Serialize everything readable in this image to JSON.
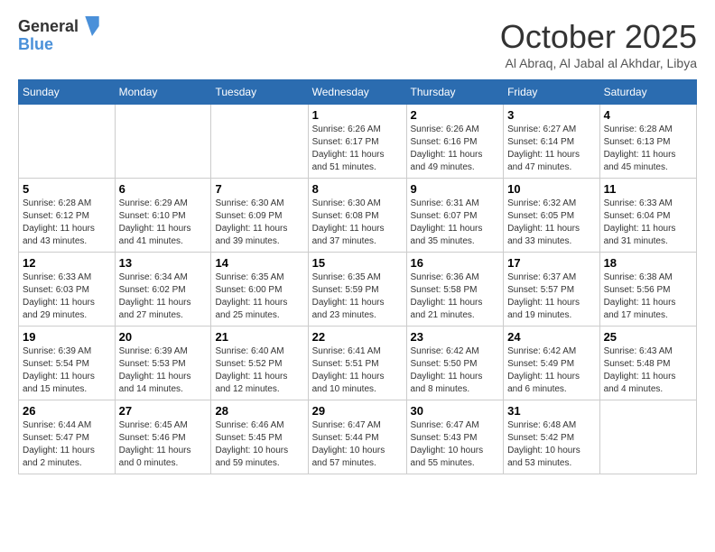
{
  "header": {
    "logo_line1": "General",
    "logo_line2": "Blue",
    "month": "October 2025",
    "location": "Al Abraq, Al Jabal al Akhdar, Libya"
  },
  "weekdays": [
    "Sunday",
    "Monday",
    "Tuesday",
    "Wednesday",
    "Thursday",
    "Friday",
    "Saturday"
  ],
  "weeks": [
    [
      {
        "day": "",
        "info": ""
      },
      {
        "day": "",
        "info": ""
      },
      {
        "day": "",
        "info": ""
      },
      {
        "day": "1",
        "info": "Sunrise: 6:26 AM\nSunset: 6:17 PM\nDaylight: 11 hours\nand 51 minutes."
      },
      {
        "day": "2",
        "info": "Sunrise: 6:26 AM\nSunset: 6:16 PM\nDaylight: 11 hours\nand 49 minutes."
      },
      {
        "day": "3",
        "info": "Sunrise: 6:27 AM\nSunset: 6:14 PM\nDaylight: 11 hours\nand 47 minutes."
      },
      {
        "day": "4",
        "info": "Sunrise: 6:28 AM\nSunset: 6:13 PM\nDaylight: 11 hours\nand 45 minutes."
      }
    ],
    [
      {
        "day": "5",
        "info": "Sunrise: 6:28 AM\nSunset: 6:12 PM\nDaylight: 11 hours\nand 43 minutes."
      },
      {
        "day": "6",
        "info": "Sunrise: 6:29 AM\nSunset: 6:10 PM\nDaylight: 11 hours\nand 41 minutes."
      },
      {
        "day": "7",
        "info": "Sunrise: 6:30 AM\nSunset: 6:09 PM\nDaylight: 11 hours\nand 39 minutes."
      },
      {
        "day": "8",
        "info": "Sunrise: 6:30 AM\nSunset: 6:08 PM\nDaylight: 11 hours\nand 37 minutes."
      },
      {
        "day": "9",
        "info": "Sunrise: 6:31 AM\nSunset: 6:07 PM\nDaylight: 11 hours\nand 35 minutes."
      },
      {
        "day": "10",
        "info": "Sunrise: 6:32 AM\nSunset: 6:05 PM\nDaylight: 11 hours\nand 33 minutes."
      },
      {
        "day": "11",
        "info": "Sunrise: 6:33 AM\nSunset: 6:04 PM\nDaylight: 11 hours\nand 31 minutes."
      }
    ],
    [
      {
        "day": "12",
        "info": "Sunrise: 6:33 AM\nSunset: 6:03 PM\nDaylight: 11 hours\nand 29 minutes."
      },
      {
        "day": "13",
        "info": "Sunrise: 6:34 AM\nSunset: 6:02 PM\nDaylight: 11 hours\nand 27 minutes."
      },
      {
        "day": "14",
        "info": "Sunrise: 6:35 AM\nSunset: 6:00 PM\nDaylight: 11 hours\nand 25 minutes."
      },
      {
        "day": "15",
        "info": "Sunrise: 6:35 AM\nSunset: 5:59 PM\nDaylight: 11 hours\nand 23 minutes."
      },
      {
        "day": "16",
        "info": "Sunrise: 6:36 AM\nSunset: 5:58 PM\nDaylight: 11 hours\nand 21 minutes."
      },
      {
        "day": "17",
        "info": "Sunrise: 6:37 AM\nSunset: 5:57 PM\nDaylight: 11 hours\nand 19 minutes."
      },
      {
        "day": "18",
        "info": "Sunrise: 6:38 AM\nSunset: 5:56 PM\nDaylight: 11 hours\nand 17 minutes."
      }
    ],
    [
      {
        "day": "19",
        "info": "Sunrise: 6:39 AM\nSunset: 5:54 PM\nDaylight: 11 hours\nand 15 minutes."
      },
      {
        "day": "20",
        "info": "Sunrise: 6:39 AM\nSunset: 5:53 PM\nDaylight: 11 hours\nand 14 minutes."
      },
      {
        "day": "21",
        "info": "Sunrise: 6:40 AM\nSunset: 5:52 PM\nDaylight: 11 hours\nand 12 minutes."
      },
      {
        "day": "22",
        "info": "Sunrise: 6:41 AM\nSunset: 5:51 PM\nDaylight: 11 hours\nand 10 minutes."
      },
      {
        "day": "23",
        "info": "Sunrise: 6:42 AM\nSunset: 5:50 PM\nDaylight: 11 hours\nand 8 minutes."
      },
      {
        "day": "24",
        "info": "Sunrise: 6:42 AM\nSunset: 5:49 PM\nDaylight: 11 hours\nand 6 minutes."
      },
      {
        "day": "25",
        "info": "Sunrise: 6:43 AM\nSunset: 5:48 PM\nDaylight: 11 hours\nand 4 minutes."
      }
    ],
    [
      {
        "day": "26",
        "info": "Sunrise: 6:44 AM\nSunset: 5:47 PM\nDaylight: 11 hours\nand 2 minutes."
      },
      {
        "day": "27",
        "info": "Sunrise: 6:45 AM\nSunset: 5:46 PM\nDaylight: 11 hours\nand 0 minutes."
      },
      {
        "day": "28",
        "info": "Sunrise: 6:46 AM\nSunset: 5:45 PM\nDaylight: 10 hours\nand 59 minutes."
      },
      {
        "day": "29",
        "info": "Sunrise: 6:47 AM\nSunset: 5:44 PM\nDaylight: 10 hours\nand 57 minutes."
      },
      {
        "day": "30",
        "info": "Sunrise: 6:47 AM\nSunset: 5:43 PM\nDaylight: 10 hours\nand 55 minutes."
      },
      {
        "day": "31",
        "info": "Sunrise: 6:48 AM\nSunset: 5:42 PM\nDaylight: 10 hours\nand 53 minutes."
      },
      {
        "day": "",
        "info": ""
      }
    ]
  ]
}
